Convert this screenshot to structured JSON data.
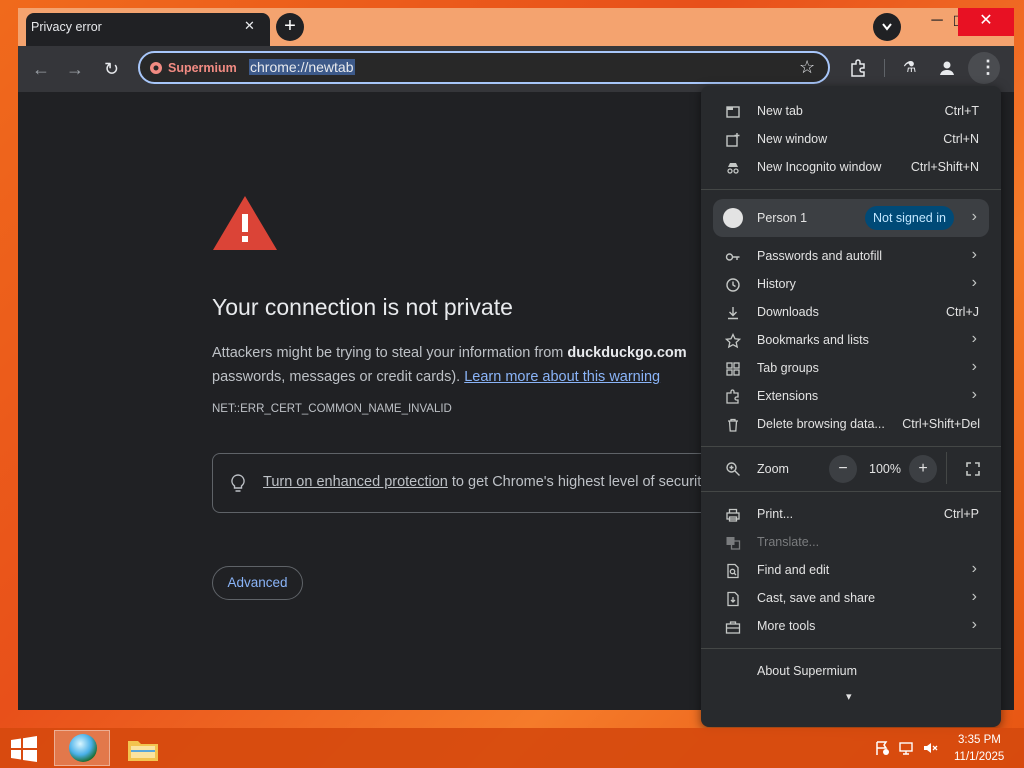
{
  "tab": {
    "title": "Privacy error",
    "close_glyph": "✕",
    "new_tab_glyph": "+"
  },
  "window_controls": {
    "minimize": "─",
    "maximize": "☐",
    "close": "✕"
  },
  "toolbar": {
    "site_name": "Supermium",
    "url": "chrome://newtab",
    "back_glyph": "←",
    "forward_glyph": "→",
    "reload_glyph": "↻",
    "bookmark_glyph": "☆",
    "labs_glyph": "⚗",
    "menu_glyph": "⋮"
  },
  "page": {
    "title": "Your connection is not private",
    "body_1": "Attackers might be trying to steal your information from ",
    "body_domain": "duckduckgo.com",
    "body_2": "passwords, messages or credit cards). ",
    "learn_more": "Learn more about this warning",
    "error_code": "NET::ERR_CERT_COMMON_NAME_INVALID",
    "protection_link": "Turn on enhanced protection",
    "protection_rest": " to get Chrome's highest level of security",
    "advanced": "Advanced"
  },
  "menu": {
    "new_tab": {
      "label": "New tab",
      "shortcut": "Ctrl+T"
    },
    "new_window": {
      "label": "New window",
      "shortcut": "Ctrl+N"
    },
    "incognito": {
      "label": "New Incognito window",
      "shortcut": "Ctrl+Shift+N"
    },
    "profile": {
      "name": "Person 1",
      "status": "Not signed in"
    },
    "passwords": {
      "label": "Passwords and autofill"
    },
    "history": {
      "label": "History"
    },
    "downloads": {
      "label": "Downloads",
      "shortcut": "Ctrl+J"
    },
    "bookmarks": {
      "label": "Bookmarks and lists"
    },
    "tab_groups": {
      "label": "Tab groups"
    },
    "extensions": {
      "label": "Extensions"
    },
    "delete_data": {
      "label": "Delete browsing data...",
      "shortcut": "Ctrl+Shift+Del"
    },
    "zoom": {
      "label": "Zoom",
      "value": "100%",
      "minus": "−",
      "plus": "+"
    },
    "print": {
      "label": "Print...",
      "shortcut": "Ctrl+P"
    },
    "translate": {
      "label": "Translate..."
    },
    "find_edit": {
      "label": "Find and edit"
    },
    "cast_save": {
      "label": "Cast, save and share"
    },
    "more_tools": {
      "label": "More tools"
    },
    "about": {
      "label": "About Supermium"
    },
    "more_glyph": "▾",
    "arrow_glyph": "›"
  },
  "taskbar": {
    "time": "3:35 PM",
    "date": "11/1/2025"
  },
  "colors": {
    "accent": "#8ab4f8",
    "warning": "#db4437",
    "background": "#202124",
    "menu": "#282a2d"
  }
}
